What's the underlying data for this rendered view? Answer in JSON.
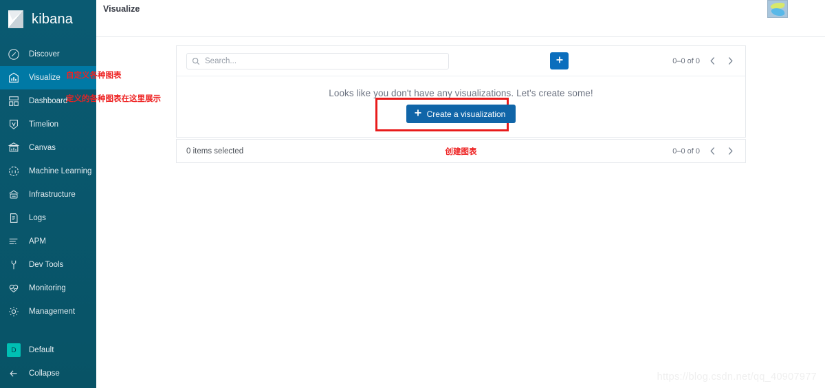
{
  "sidebar": {
    "brand": {
      "name": "kibana",
      "icon": "kibana-logo-icon"
    },
    "items": [
      {
        "label": "Discover",
        "icon": "compass-icon",
        "active": false
      },
      {
        "label": "Visualize",
        "icon": "bar-chart-icon",
        "active": true
      },
      {
        "label": "Dashboard",
        "icon": "dashboard-grid-icon",
        "active": false
      },
      {
        "label": "Timelion",
        "icon": "timelion-shield-icon",
        "active": false
      },
      {
        "label": "Canvas",
        "icon": "canvas-easel-icon",
        "active": false
      },
      {
        "label": "Machine Learning",
        "icon": "machine-learning-icon",
        "active": false
      },
      {
        "label": "Infrastructure",
        "icon": "infrastructure-icon",
        "active": false
      },
      {
        "label": "Logs",
        "icon": "logs-document-icon",
        "active": false
      },
      {
        "label": "APM",
        "icon": "apm-lines-icon",
        "active": false
      },
      {
        "label": "Dev Tools",
        "icon": "wrench-icon",
        "active": false
      },
      {
        "label": "Monitoring",
        "icon": "heartbeat-icon",
        "active": false
      },
      {
        "label": "Management",
        "icon": "gear-icon",
        "active": false
      }
    ],
    "space": {
      "label": "Default",
      "badge": "D",
      "badge_color": "#00bfb3"
    },
    "collapse": {
      "label": "Collapse",
      "icon": "arrow-left-icon"
    }
  },
  "header": {
    "title": "Visualize",
    "logo_icon": "app-logo-icon"
  },
  "toolbar": {
    "search_placeholder": "Search...",
    "search_value": "",
    "search_icon": "search-icon",
    "add_button_label": "+",
    "add_button_icon": "plus-icon",
    "pagination": {
      "count": "0–0 of 0",
      "prev_icon": "chevron-left-icon",
      "next_icon": "chevron-right-icon"
    }
  },
  "empty_state": {
    "message": "Looks like you don't have any visualizations. Let's create some!",
    "create_button_label": "Create a visualization",
    "create_button_icon": "plus-icon"
  },
  "footer": {
    "selected_text": "0 items selected",
    "note": "创建图表",
    "pagination": {
      "count": "0–0 of 0",
      "prev_icon": "chevron-left-icon",
      "next_icon": "chevron-right-icon"
    }
  },
  "annotations": {
    "visualize": "自定义各种图表",
    "dashboard": "定义的各种图表在这里展示",
    "color": "#ee2222"
  },
  "watermark": "https://blog.csdn.net/qq_40907977",
  "colors": {
    "sidebar_bg": "#08546b",
    "sidebar_active": "#0079a5",
    "primary_blue": "#0b6ebd",
    "create_blue": "#1065a8",
    "highlight_red": "#e81b1b"
  }
}
